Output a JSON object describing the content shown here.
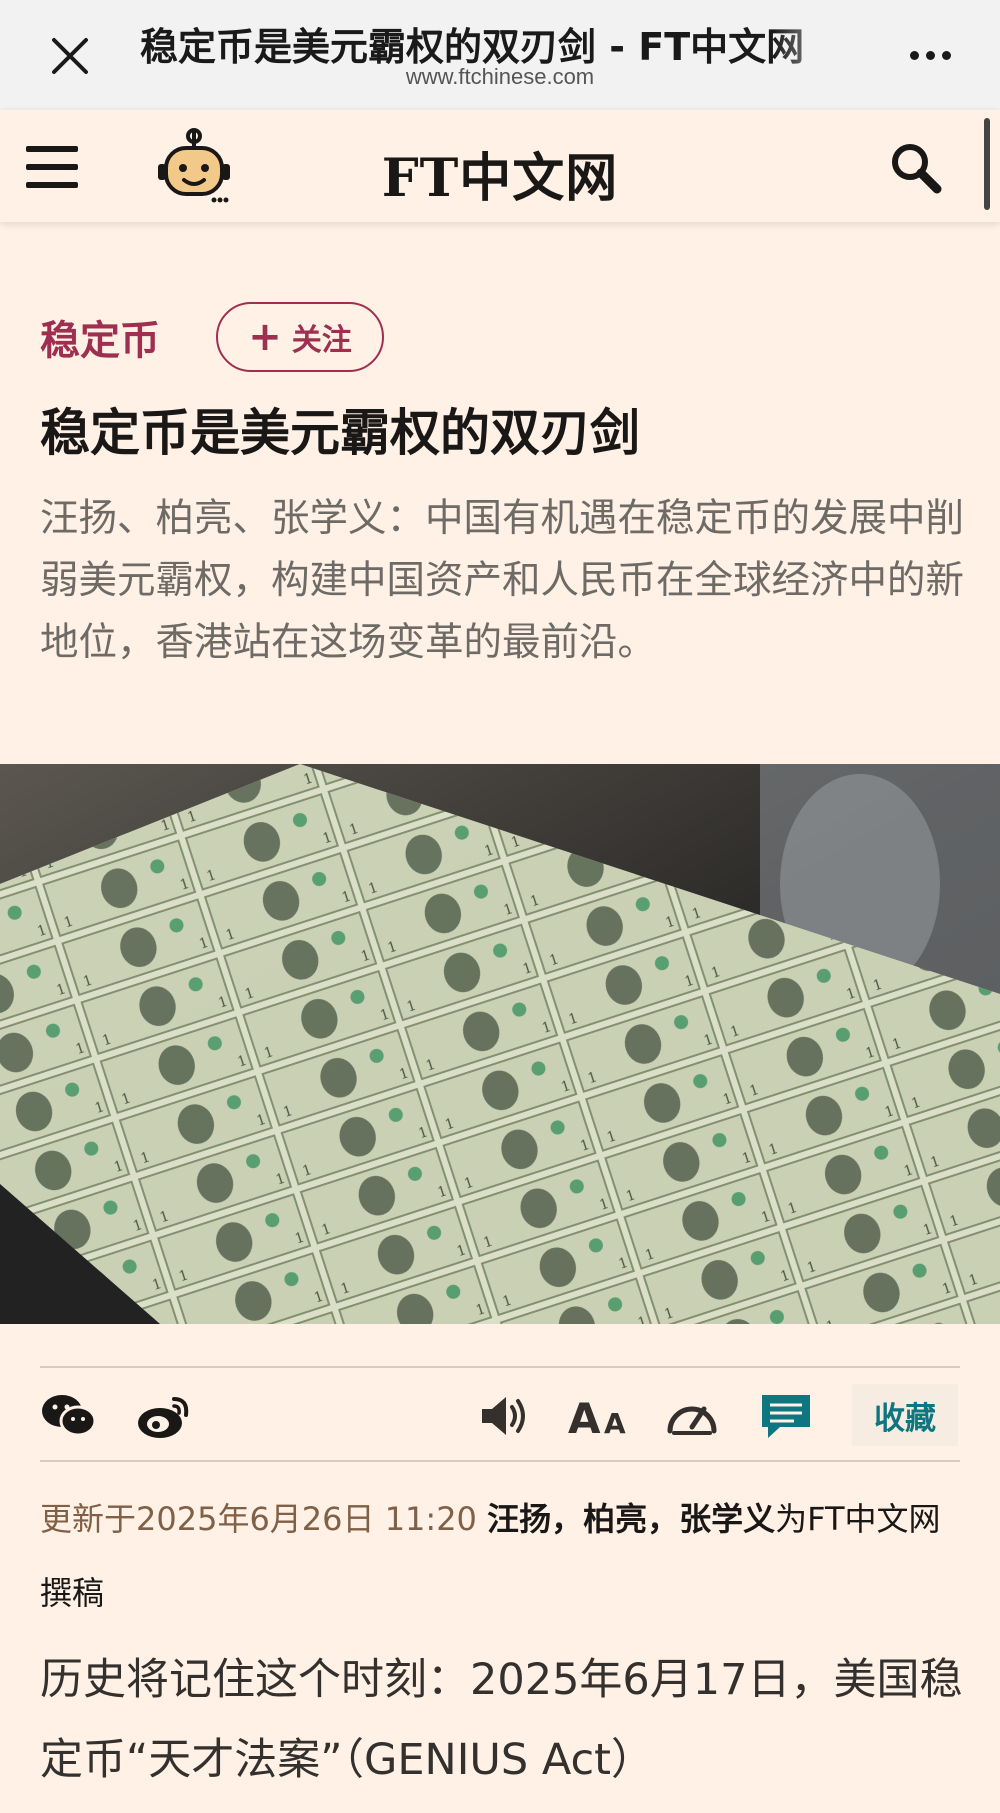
{
  "browser": {
    "title": "稳定币是美元霸权的双刃剑 - FT中文网",
    "url": "www.ftchinese.com"
  },
  "site": {
    "logo": "FT中文网"
  },
  "article": {
    "topic": "稳定币",
    "follow_label": "关注",
    "headline": "稳定币是美元霸权的双刃剑",
    "standfirst": "汪扬、柏亮、张学义：中国有机遇在稳定币的发展中削弱美元霸权，构建中国资产和人民币在全球经济中的新地位，香港站在这场变革的最前沿。",
    "photo_alt": "Sheet of uncut one-dollar bills on a printing press",
    "toolbar": {
      "favorite_label": "收藏"
    },
    "byline": {
      "updated": "更新于2025年6月26日 11:20",
      "authors": "汪扬，柏亮，张学义",
      "suffix": "为FT中文网撰稿"
    },
    "body_first": "历史将记住这个时刻：2025年6月17日，美国稳定币“天才法案”（GENIUS Act）"
  },
  "icons": {
    "close": "close-icon",
    "more": "more-icon",
    "menu": "menu-icon",
    "robot": "robot-icon",
    "search": "search-icon",
    "wechat": "wechat-icon",
    "weibo": "weibo-icon",
    "audio": "speaker-icon",
    "font_size": "font-size-icon",
    "speed": "speedometer-icon",
    "comment": "comment-icon"
  },
  "colors": {
    "page_bg": "#fff1e5",
    "accent": "#9e2f50",
    "teal": "#0d7680",
    "date": "#806046"
  }
}
